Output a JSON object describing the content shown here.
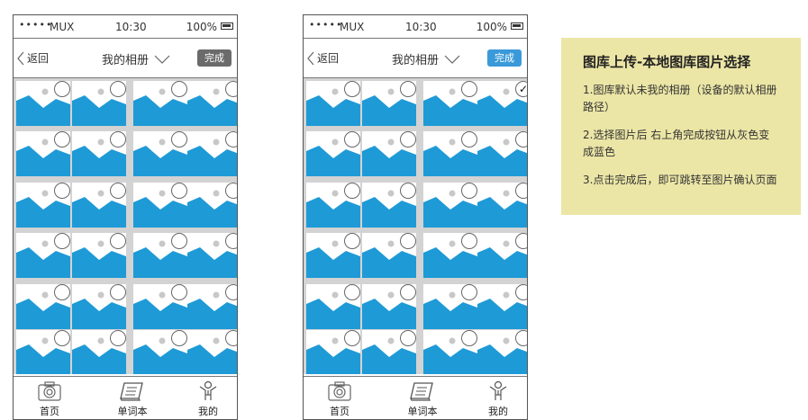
{
  "colors": {
    "done_gray": "#6b6b6b",
    "done_blue": "#3a9ad9",
    "photo_blue": "#1e9ad6",
    "note_bg": "#ece6a6"
  },
  "phones": [
    {
      "status": {
        "signal": "•••••",
        "carrier": "MUX",
        "time": "10:30",
        "battery": "100%"
      },
      "nav": {
        "back": "返回",
        "title": "我的相册",
        "done": "完成",
        "done_state": "gray"
      },
      "selected": []
    },
    {
      "status": {
        "signal": "•••••",
        "carrier": "MUX",
        "time": "10:30",
        "battery": "100%"
      },
      "nav": {
        "back": "返回",
        "title": "我的相册",
        "done": "完成",
        "done_state": "blue"
      },
      "selected": [
        3
      ]
    }
  ],
  "tabs": [
    {
      "label": "首页",
      "icon": "camera-icon"
    },
    {
      "label": "单词本",
      "icon": "notebook-icon"
    },
    {
      "label": "我的",
      "icon": "person-icon"
    }
  ],
  "note": {
    "title": "图库上传-本地图库图片选择",
    "items": [
      "1.图库默认未我的相册（设备的默认相册路径）",
      "2.选择图片后 右上角完成按钮从灰色变成蓝色",
      "3.点击完成后，即可跳转至图片确认页面"
    ]
  }
}
